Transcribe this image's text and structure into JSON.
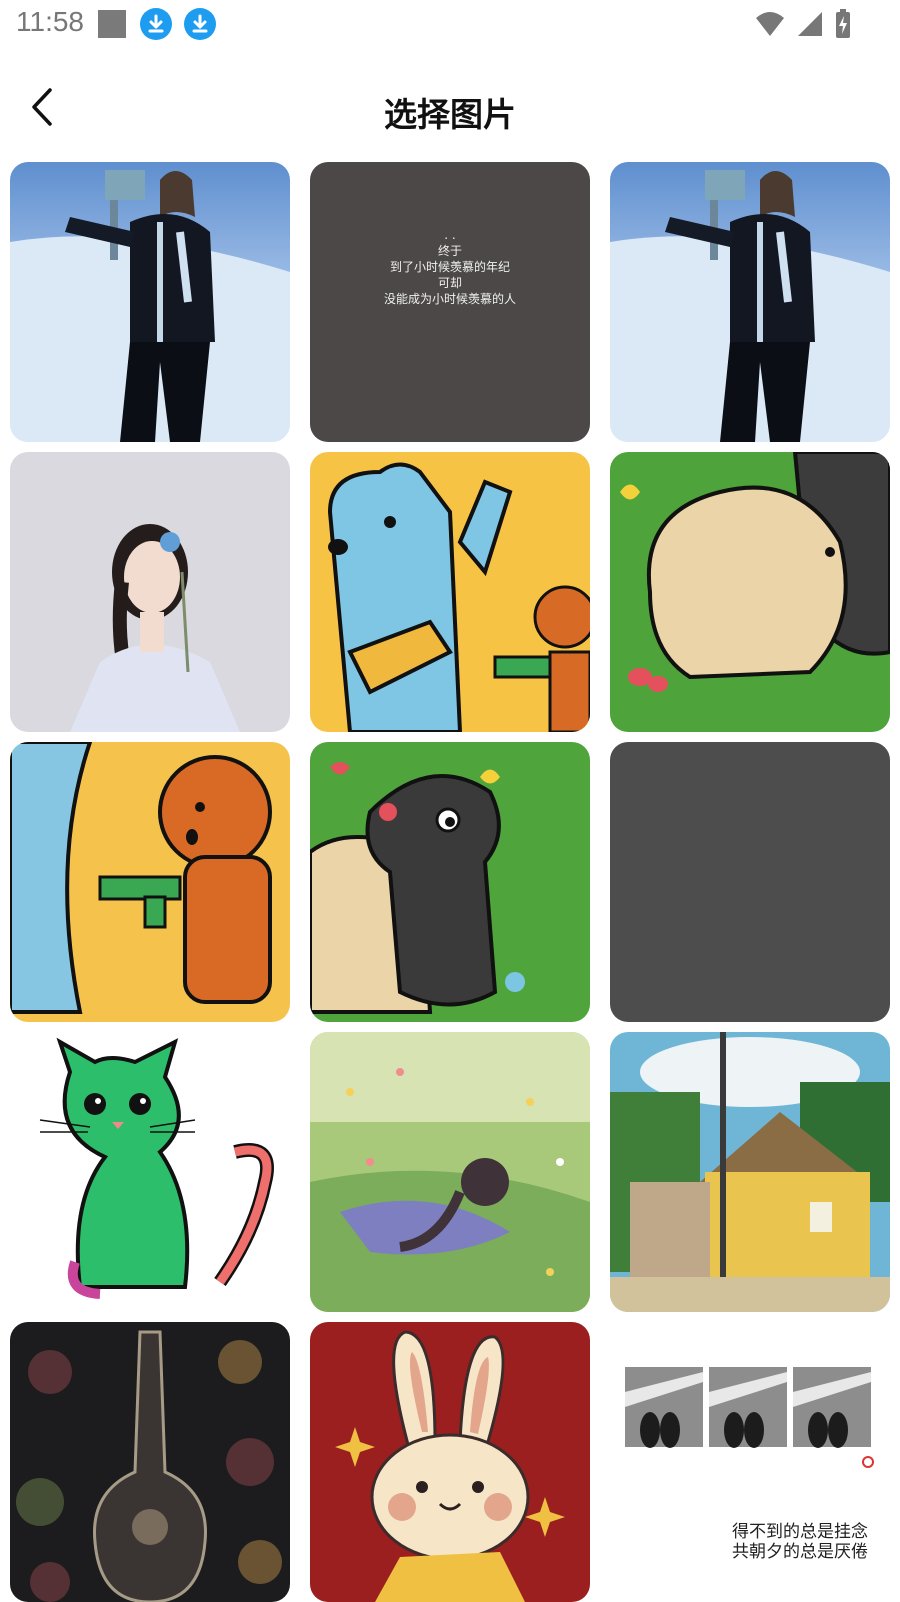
{
  "status_bar": {
    "time": "11:58",
    "icons": [
      "square-notification-icon",
      "download-icon",
      "download-icon",
      "wifi-icon",
      "signal-icon",
      "battery-charging-icon"
    ]
  },
  "header": {
    "back_icon": "chevron-left-icon",
    "title": "选择图片"
  },
  "grid": {
    "items": [
      {
        "name": "skier-woman-photo"
      },
      {
        "name": "quote-card",
        "text": ". .\n终于\n到了小时候羡慕的年纪\n可却\n没能成为小时候羡慕的人"
      },
      {
        "name": "skier-woman-photo"
      },
      {
        "name": "woman-portrait-photo"
      },
      {
        "name": "blue-bear-cartoon"
      },
      {
        "name": "dog-hug-cartoon"
      },
      {
        "name": "poodle-gun-cartoon"
      },
      {
        "name": "black-dog-cartoon"
      },
      {
        "name": "blank-gray-image"
      },
      {
        "name": "green-cat-drawing"
      },
      {
        "name": "girl-in-meadow-painting"
      },
      {
        "name": "yellow-house-painting"
      },
      {
        "name": "guitar-flowers-art"
      },
      {
        "name": "rabbit-cartoon"
      },
      {
        "name": "couple-photo-collage",
        "text": "得不到的总是挂念\n共朝夕的总是厌倦"
      }
    ]
  }
}
